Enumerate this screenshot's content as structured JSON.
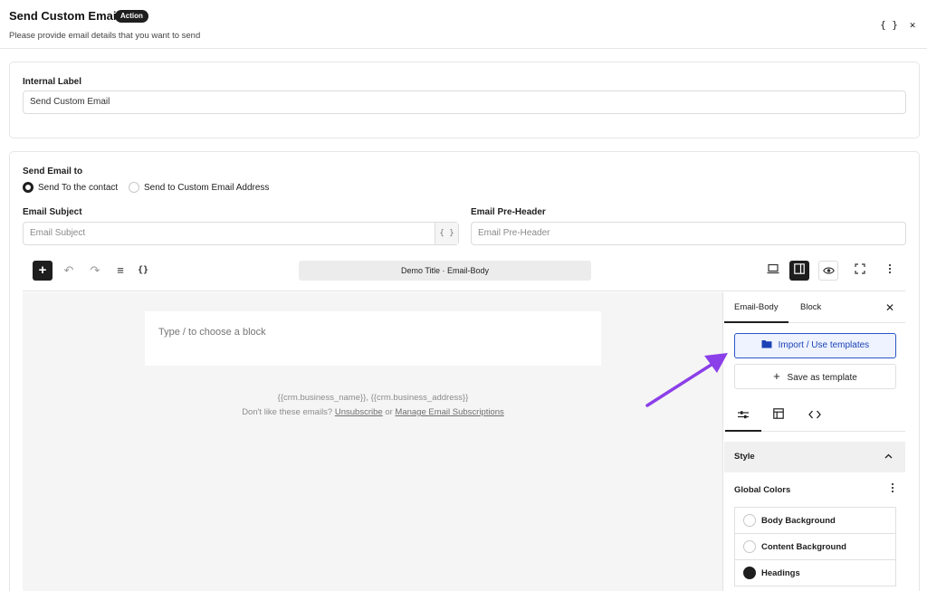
{
  "header": {
    "title": "Send Custom Email",
    "badge": "Action",
    "subtitle": "Please provide email details that you want to send",
    "merge_tags_glyph": "{ }",
    "close_glyph": "✕"
  },
  "internal_label": {
    "label": "Internal Label",
    "value": "Send Custom Email"
  },
  "send_to": {
    "label": "Send Email to",
    "options": [
      {
        "label": "Send To the contact",
        "checked": true
      },
      {
        "label": "Send to Custom Email Address",
        "checked": false
      }
    ]
  },
  "subject": {
    "label": "Email Subject",
    "placeholder": "Email Subject",
    "merge_tag_glyph": "{ }"
  },
  "preheader": {
    "label": "Email Pre-Header",
    "placeholder": "Email Pre-Header"
  },
  "editor_toolbar": {
    "add_glyph": "+",
    "undo_glyph": "↶",
    "redo_glyph": "↷",
    "outline_glyph": "≡",
    "code_glyph": "{}",
    "doc_title": "Demo Title · Email-Body",
    "icons": [
      "plus-icon",
      "undo-icon",
      "redo-icon",
      "document-outline-icon",
      "merge-tags-icon",
      "desktop-preview-icon",
      "sidebar-toggle-icon",
      "eye-icon",
      "fullscreen-icon",
      "more-vertical-icon"
    ]
  },
  "canvas": {
    "block_placeholder": "Type / to choose a block",
    "footer_merge": "{{crm.business_name}}, {{crm.business_address}}",
    "footer_prefix": "Don't like these emails?",
    "unsubscribe": "Unsubscribe",
    "or": "or",
    "manage": "Manage Email Subscriptions"
  },
  "sidebar": {
    "tabs": [
      {
        "label": "Email-Body",
        "active": true
      },
      {
        "label": "Block",
        "active": false
      }
    ],
    "close_glyph": "✕",
    "import_label": "Import / Use templates",
    "save_label": "Save as template",
    "icon_tabs": [
      "sliders-icon",
      "layout-icon",
      "code-icon"
    ],
    "style_title": "Style",
    "global_colors_title": "Global Colors",
    "colors": [
      {
        "label": "Body Background",
        "swatch": "#ffffff"
      },
      {
        "label": "Content Background",
        "swatch": "#ffffff"
      },
      {
        "label": "Headings",
        "swatch": "#1e1e1e"
      }
    ]
  },
  "colors": {
    "accent": "#2d55c9",
    "annotation_arrow": "#8b3fe8"
  }
}
